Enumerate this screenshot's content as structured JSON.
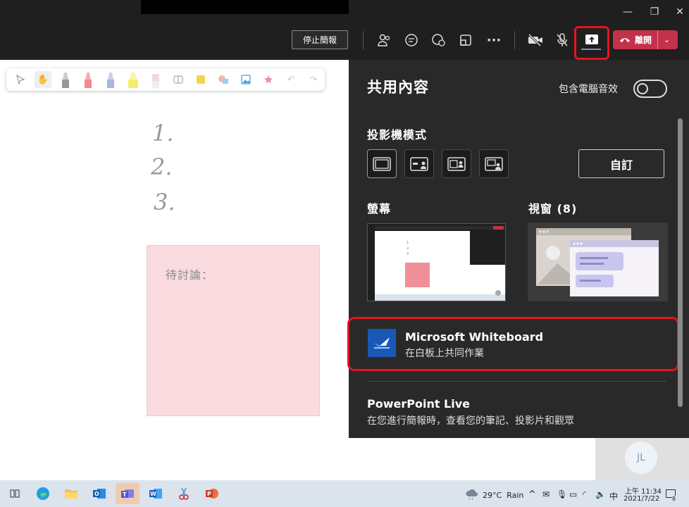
{
  "window": {
    "minimize": "—",
    "restore": "❐",
    "close": "✕"
  },
  "toolbar": {
    "stop_presenting": "停止簡報",
    "leave": "離開",
    "icons": [
      "people-icon",
      "chat-icon",
      "reactions-icon",
      "rooms-icon",
      "more-icon",
      "camera-off-icon",
      "mic-off-icon",
      "share-icon"
    ]
  },
  "whiteboard": {
    "tools": [
      "select-icon",
      "hand-icon",
      "pen-gray-icon",
      "pen-red-icon",
      "pen-blue-icon",
      "highlighter-yellow-icon",
      "eraser-icon",
      "ruler-icon",
      "note-icon",
      "shape-icon",
      "image-icon",
      "reaction-icon",
      "undo-icon",
      "redo-icon"
    ],
    "lines": [
      "1.",
      "2.",
      "3."
    ],
    "sticky_text": "待討論："
  },
  "share_panel": {
    "title": "共用內容",
    "include_audio": "包含電腦音效",
    "presenter_mode_label": "投影機模式",
    "custom_button": "自訂",
    "screen_label": "螢幕",
    "windows_label": "視窗 (8)",
    "whiteboard_title": "Microsoft Whiteboard",
    "whiteboard_sub": "在白板上共同作業",
    "ppt_title": "PowerPoint Live",
    "ppt_sub": "在您進行簡報時，查看您的筆記、投影片和觀眾"
  },
  "participant": {
    "initials": "JL"
  },
  "taskbar": {
    "weather": "29°C  Rain",
    "ime": "中",
    "time_line1": "上午 11:34",
    "time_line2": "2021/7/22",
    "notif_count": "8"
  }
}
